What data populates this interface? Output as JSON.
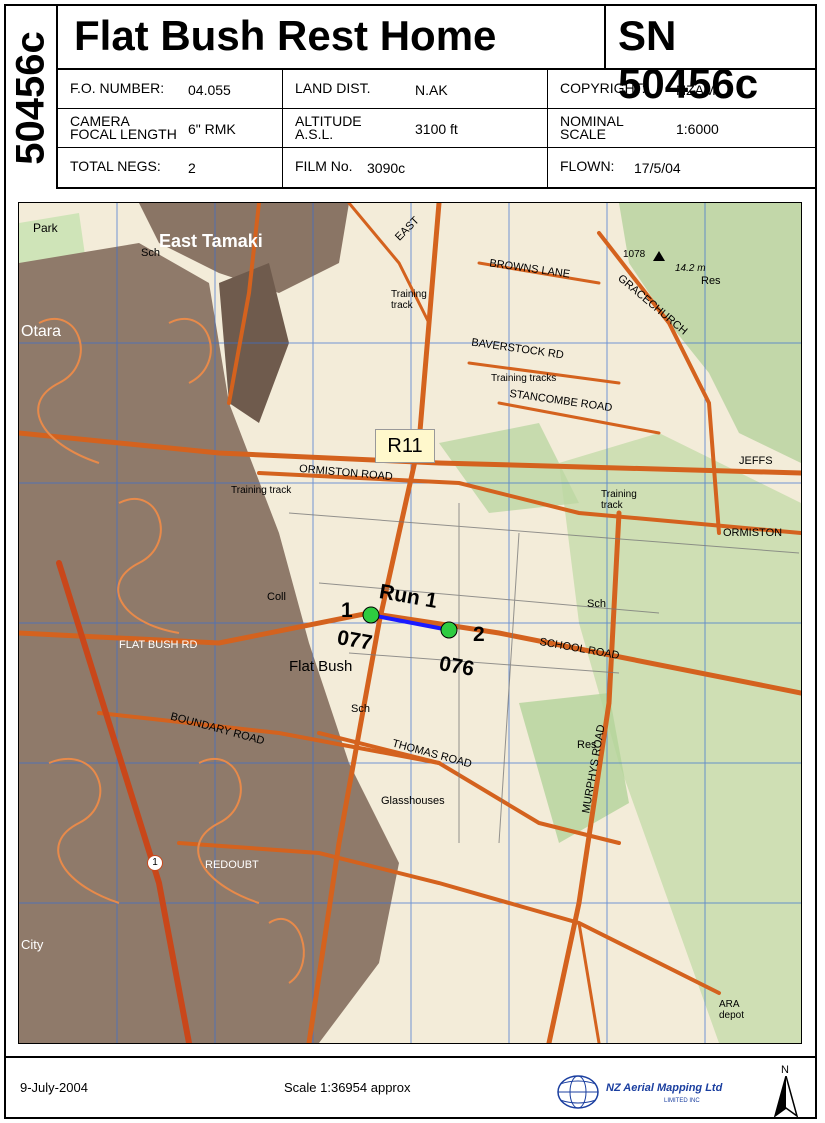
{
  "header": {
    "vertical_code": "50456c",
    "title": "Flat Bush Rest Home",
    "sn": "SN 50456c"
  },
  "info": {
    "fo_number_label": "F.O. NUMBER:",
    "fo_number": "04.055",
    "land_dist_label": "LAND DIST.",
    "land_dist": "N.AK",
    "copyright_label": "COPYRIGHT:",
    "copyright": "NZAM",
    "camera_label_1": "CAMERA",
    "camera_label_2": "FOCAL LENGTH",
    "camera": "6\" RMK",
    "altitude_label_1": "ALTITUDE",
    "altitude_label_2": "A.S.L.",
    "altitude": "3100 ft",
    "nominal_label_1": "NOMINAL",
    "nominal_label_2": "SCALE",
    "nominal_scale": "1:6000",
    "total_negs_label": "TOTAL NEGS:",
    "total_negs": "2",
    "film_label": "FILM No.",
    "film_no": "3090c",
    "flown_label": "FLOWN:",
    "flown": "17/5/04"
  },
  "map": {
    "place_labels": {
      "east_tamaki": "East Tamaki",
      "otara": "Otara",
      "flat_bush": "Flat Bush",
      "glasshouses": "Glasshouses",
      "park": "Park",
      "city": "City",
      "ara_depot": "ARA depot"
    },
    "road_labels": {
      "browns_lane": "BROWNS LANE",
      "baverstock": "BAVERSTOCK RD",
      "stancombe": "STANCOMBE ROAD",
      "ormiston": "ORMISTON ROAD",
      "ormiston_e": "ORMISTON",
      "jeffs": "JEFFS",
      "school": "SCHOOL ROAD",
      "flat_bush_rd": "FLAT BUSH RD",
      "boundary": "BOUNDARY ROAD",
      "thomas": "THOMAS ROAD",
      "redoubt": "REDOUBT",
      "murphys": "MURPHYS ROAD",
      "east": "EAST",
      "gracechurch": "GRACECHURCH"
    },
    "misc_labels": {
      "training_track": "Training track",
      "training_tracks": "Training tracks",
      "sch": "Sch",
      "res": "Res",
      "coll": "Coll",
      "spot_height": "14.2 m",
      "trig": "1078",
      "route": "1"
    },
    "region_label": "R11",
    "run": {
      "label": "Run 1",
      "start_num": "1",
      "start_frame": "077",
      "end_num": "2",
      "end_frame": "076"
    },
    "colors": {
      "road": "#d4621e",
      "urban": "#7a6556",
      "grid": "#3a6fd1",
      "vegetation": "#9ec78a",
      "run_line": "#1a1aff",
      "run_point": "#2ecc40",
      "background": "#f3ecd9"
    }
  },
  "footer": {
    "date": "9-July-2004",
    "scale": "Scale  1:36954 approx",
    "company": "NZ Aerial Mapping Ltd",
    "company_sub": "LIMITED INC",
    "north": "N"
  }
}
